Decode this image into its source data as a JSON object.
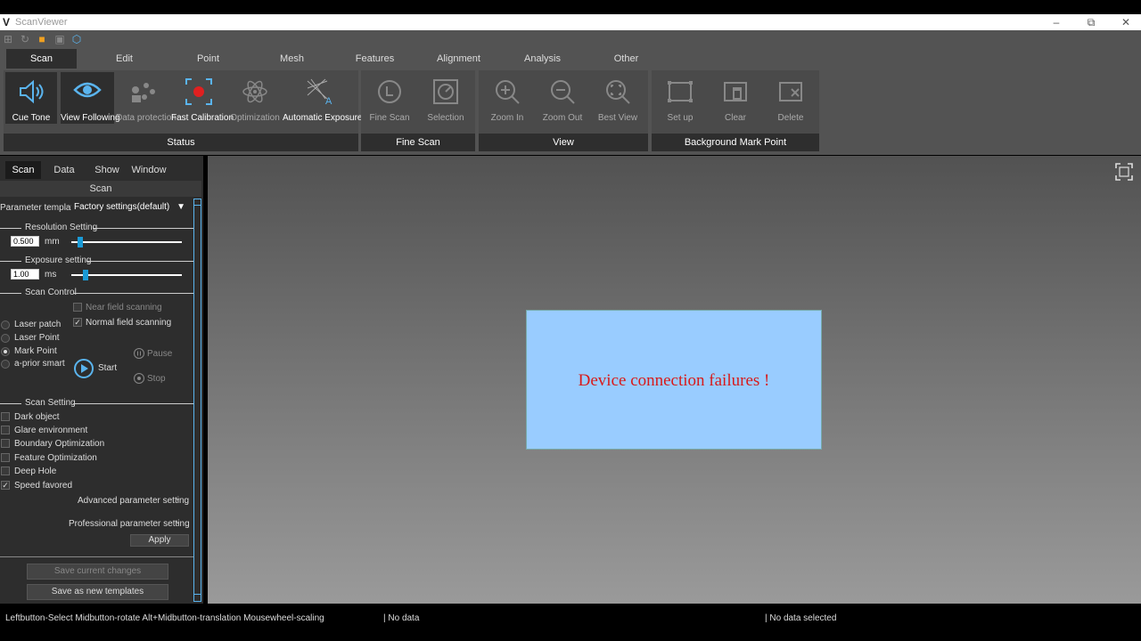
{
  "window": {
    "title": "ScanViewer",
    "logo": "V"
  },
  "quick_icons": [
    "new-project-icon",
    "refresh-icon",
    "open-folder-icon",
    "save-icon",
    "3d-view-icon"
  ],
  "menu_tabs": [
    "Scan",
    "Edit",
    "Point",
    "Mesh",
    "Features",
    "Alignment",
    "Analysis",
    "Other"
  ],
  "ribbon": {
    "status": {
      "label": "Status",
      "buttons": [
        "Cue Tone",
        "View Following",
        "Data protection",
        "Fast Calibration",
        "Optimization",
        "Automatic Exposure"
      ]
    },
    "fine_scan": {
      "label": "Fine Scan",
      "buttons": [
        "Fine Scan",
        "Selection"
      ]
    },
    "view": {
      "label": "View",
      "buttons": [
        "Zoom In",
        "Zoom Out",
        "Best View"
      ]
    },
    "background": {
      "label": "Background Mark Point",
      "buttons": [
        "Set up",
        "Clear",
        "Delete"
      ]
    }
  },
  "panel": {
    "tabs": [
      "Scan",
      "Data",
      "Show",
      "Window"
    ],
    "header": "Scan",
    "param_template_label": "Parameter template",
    "param_template_value": "Factory settings(default)",
    "resolution": {
      "title": "Resolution Setting",
      "value": "0.500",
      "unit": "mm",
      "level": 0.08
    },
    "exposure": {
      "title": "Exposure setting",
      "value": "1.00",
      "unit": "ms",
      "level": 0.13
    },
    "scan_control": {
      "title": "Scan Control",
      "near_field": "Near field scanning",
      "normal_field": "Normal field scanning",
      "modes": [
        "Laser patch",
        "Laser Point",
        "Mark Point",
        "a-prior smart"
      ],
      "start": "Start",
      "pause": "Pause",
      "stop": "Stop"
    },
    "scan_setting": {
      "title": "Scan Setting",
      "options": [
        "Dark object",
        "Glare environment",
        "Boundary Optimization",
        "Feature Optimization",
        "Deep Hole",
        "Speed favored"
      ],
      "advanced": "Advanced parameter setting",
      "professional": "Professional parameter setting",
      "apply": "Apply"
    },
    "save_current": "Save current changes",
    "save_new": "Save as new templates"
  },
  "alert_message": "Device connection failures !",
  "statusbar": {
    "hint": "Leftbutton-Select Midbutton-rotate Alt+Midbutton-translation Mousewheel-scaling",
    "data": "| No data",
    "selection": "| No data selected"
  }
}
